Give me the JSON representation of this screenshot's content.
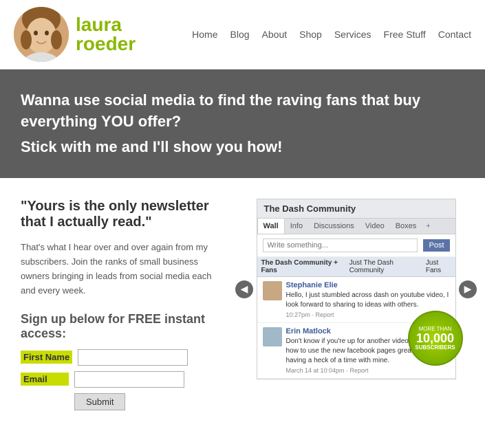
{
  "header": {
    "logo_first": "laura",
    "logo_last": "roeder",
    "nav": {
      "items": [
        {
          "label": "Home",
          "id": "nav-home"
        },
        {
          "label": "Blog",
          "id": "nav-blog"
        },
        {
          "label": "About",
          "id": "nav-about"
        },
        {
          "label": "Shop",
          "id": "nav-shop"
        },
        {
          "label": "Services",
          "id": "nav-services"
        },
        {
          "label": "Free Stuff",
          "id": "nav-freestuff"
        },
        {
          "label": "Contact",
          "id": "nav-contact"
        }
      ]
    }
  },
  "hero": {
    "line1": "Wanna use social media to find the raving fans that buy everything YOU offer?",
    "line2": "Stick with me and I'll show you how!"
  },
  "main": {
    "headline": "\"Yours is the only newsletter that I actually read.\"",
    "description": "That's what I hear over and over again from my subscribers. Join the ranks of small business owners bringing in leads from social media each and every week.",
    "signup": {
      "title": "Sign up below for FREE instant access:",
      "first_name_label": "First Name",
      "email_label": "Email",
      "submit_label": "Submit",
      "first_name_placeholder": "",
      "email_placeholder": ""
    }
  },
  "facebook": {
    "community_name": "The Dash Community",
    "tabs": [
      "Wall",
      "Info",
      "Discussions",
      "Video",
      "Boxes",
      "+"
    ],
    "write_placeholder": "Write something...",
    "post_button": "Post",
    "fan_tabs": [
      "The Dash Community + Fans",
      "Just The Dash Community",
      "Just Fans"
    ],
    "posts": [
      {
        "name": "Stephanie Elie",
        "text": "Hello, I just stumbled across dash on youtube video, I look forward to sharing to ideas with others.",
        "time": "10:27pm · Report",
        "avatar_color": "#c8a882"
      },
      {
        "name": "Erin Matlock",
        "text": "Don't know if you're up for another video tutorial on how to use the new facebook pages great! I am having a heck of a time with mine.",
        "time": "March 14 at 10:04pm · Report",
        "avatar_color": "#a0b8c8"
      }
    ]
  },
  "badge": {
    "more": "MORE THAN",
    "number": "10,000",
    "subscribers": "SUBSCRIBERS"
  },
  "arrows": {
    "left": "◀",
    "right": "▶"
  }
}
